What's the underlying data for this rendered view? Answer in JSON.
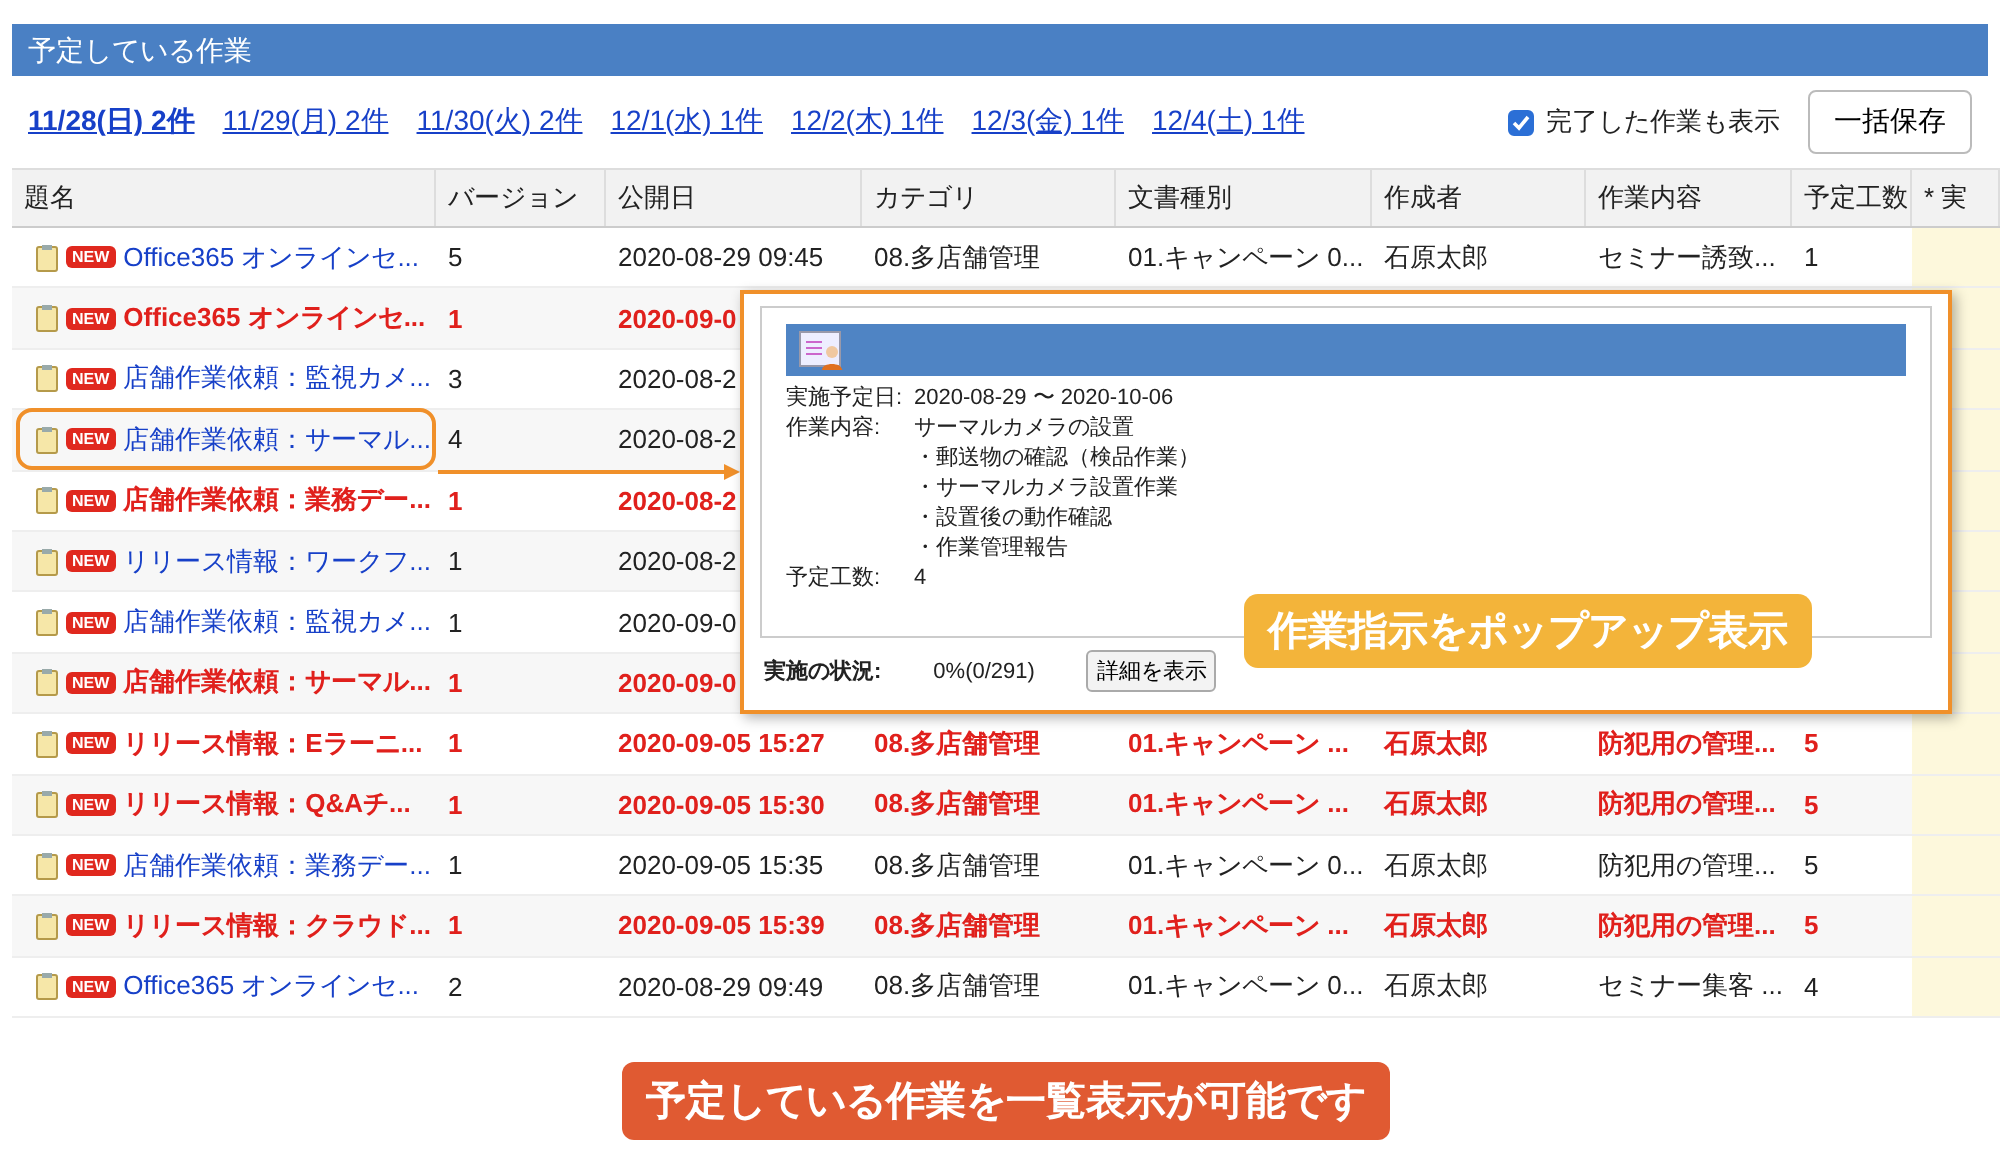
{
  "panel": {
    "title": "予定している作業"
  },
  "date_tabs": [
    {
      "label": "11/28(日) 2件",
      "selected": true
    },
    {
      "label": "11/29(月) 2件",
      "selected": false
    },
    {
      "label": "11/30(火) 2件",
      "selected": false
    },
    {
      "label": "12/1(水) 1件",
      "selected": false
    },
    {
      "label": "12/2(木) 1件",
      "selected": false
    },
    {
      "label": "12/3(金) 1件",
      "selected": false
    },
    {
      "label": "12/4(土) 1件",
      "selected": false
    }
  ],
  "show_completed": {
    "label": "完了した作業も表示",
    "checked": true
  },
  "save_button": "一括保存",
  "table": {
    "columns": [
      "題名",
      "バージョン",
      "公開日",
      "カテゴリ",
      "文書種別",
      "作成者",
      "作業内容",
      "予定工数",
      "* 実"
    ],
    "rows": [
      {
        "badge": "NEW",
        "emphasis": false,
        "highlighted": false,
        "cells": [
          "Office365 オンラインセ...",
          "5",
          "2020-08-29 09:45",
          "08.多店舗管理",
          "01.キャンペーン 0...",
          "石原太郎",
          "セミナー誘致...",
          "1"
        ]
      },
      {
        "badge": "NEW",
        "emphasis": true,
        "highlighted": false,
        "cells": [
          "Office365 オンラインセ...",
          "1",
          "2020-09-0"
        ]
      },
      {
        "badge": "NEW",
        "emphasis": false,
        "highlighted": false,
        "cells": [
          "店舗作業依頼：監視カメ...",
          "3",
          "2020-08-2"
        ]
      },
      {
        "badge": "NEW",
        "emphasis": false,
        "highlighted": true,
        "cells": [
          "店舗作業依頼：サーマル...",
          "4",
          "2020-08-2"
        ]
      },
      {
        "badge": "NEW",
        "emphasis": true,
        "highlighted": false,
        "cells": [
          "店舗作業依頼：業務デー...",
          "1",
          "2020-08-2"
        ]
      },
      {
        "badge": "NEW",
        "emphasis": false,
        "highlighted": false,
        "cells": [
          "リリース情報：ワークフ...",
          "1",
          "2020-08-2"
        ]
      },
      {
        "badge": "NEW",
        "emphasis": false,
        "highlighted": false,
        "cells": [
          "店舗作業依頼：監視カメ...",
          "1",
          "2020-09-0"
        ]
      },
      {
        "badge": "NEW",
        "emphasis": true,
        "highlighted": false,
        "cells": [
          "店舗作業依頼：サーマル...",
          "1",
          "2020-09-0"
        ]
      },
      {
        "badge": "NEW",
        "emphasis": true,
        "highlighted": false,
        "cells": [
          "リリース情報：Eラーニ...",
          "1",
          "2020-09-05 15:27",
          "08.多店舗管理",
          "01.キャンペーン ...",
          "石原太郎",
          "防犯用の管理...",
          "5"
        ]
      },
      {
        "badge": "NEW",
        "emphasis": true,
        "highlighted": false,
        "cells": [
          "リリース情報：Q&Aチ...",
          "1",
          "2020-09-05 15:30",
          "08.多店舗管理",
          "01.キャンペーン ...",
          "石原太郎",
          "防犯用の管理...",
          "5"
        ]
      },
      {
        "badge": "NEW",
        "emphasis": false,
        "highlighted": false,
        "cells": [
          "店舗作業依頼：業務デー...",
          "1",
          "2020-09-05 15:35",
          "08.多店舗管理",
          "01.キャンペーン 0...",
          "石原太郎",
          "防犯用の管理...",
          "5"
        ]
      },
      {
        "badge": "NEW",
        "emphasis": true,
        "highlighted": false,
        "cells": [
          "リリース情報：クラウド...",
          "1",
          "2020-09-05 15:39",
          "08.多店舗管理",
          "01.キャンペーン ...",
          "石原太郎",
          "防犯用の管理...",
          "5"
        ]
      },
      {
        "badge": "NEW",
        "emphasis": false,
        "highlighted": false,
        "cells": [
          "Office365 オンラインセ...",
          "2",
          "2020-08-29 09:49",
          "08.多店舗管理",
          "01.キャンペーン 0...",
          "石原太郎",
          "セミナー集客 ...",
          "4"
        ]
      }
    ]
  },
  "popup": {
    "schedule_label": "実施予定日:",
    "schedule": "2020-08-29 〜 2020-10-06",
    "content_label": "作業内容:",
    "content": [
      "サーマルカメラの設置",
      "・郵送物の確認（検品作業）",
      "・サーマルカメラ設置作業",
      "・設置後の動作確認",
      "・作業管理報告"
    ],
    "effort_label": "予定工数:",
    "effort": "4",
    "status_label": "実施の状況:",
    "status": "0%(0/291)",
    "detail_button": "詳細を表示",
    "callout": "作業指示をポップアップ表示"
  },
  "bottom_callout": "予定している作業を一覧表示が可能です"
}
